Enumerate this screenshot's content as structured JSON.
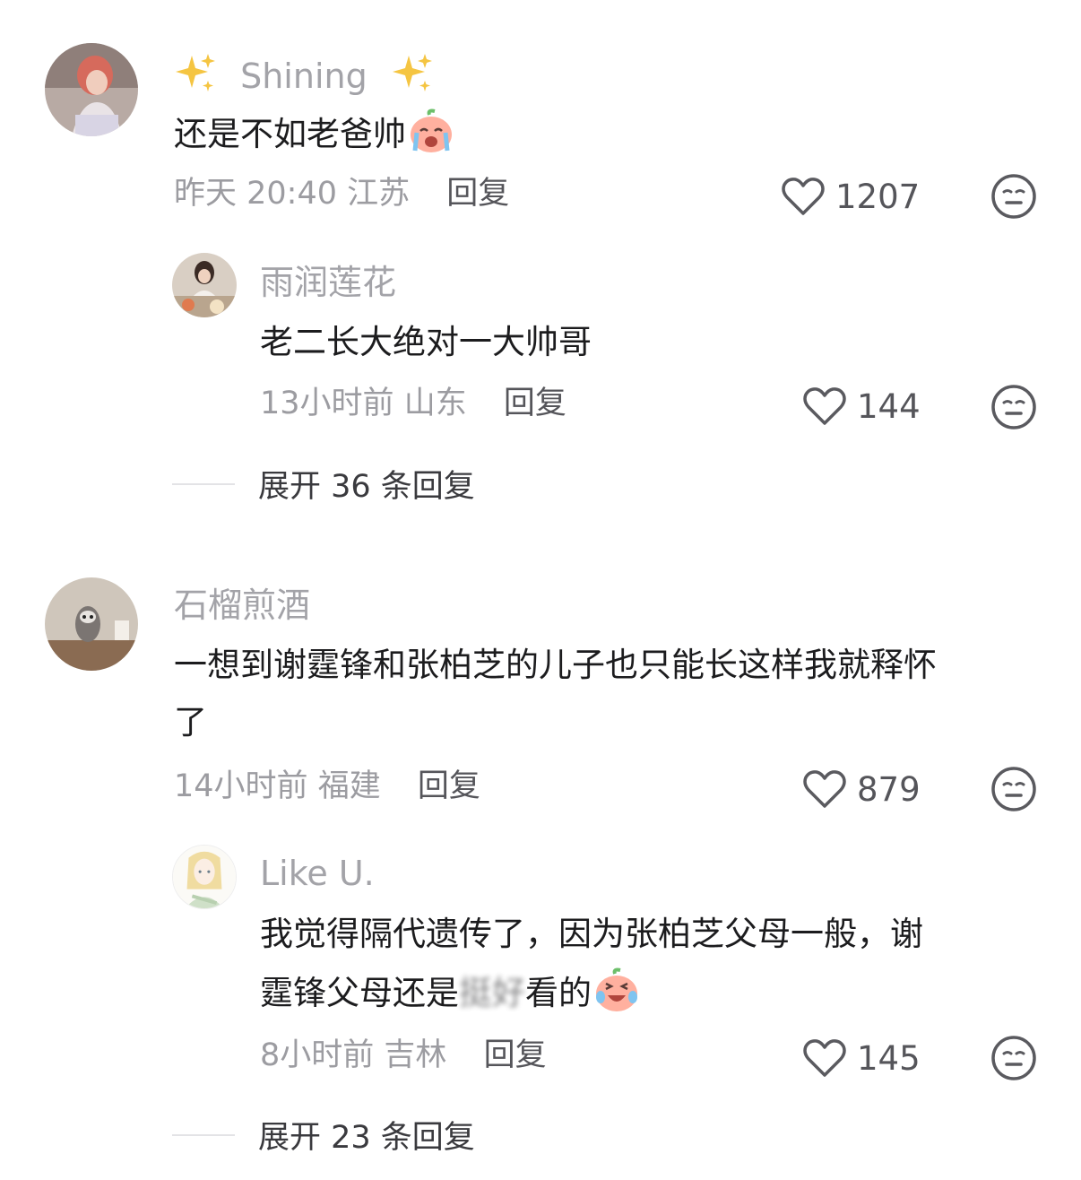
{
  "comments": [
    {
      "username": "Shining",
      "text": "还是不如老爸帅",
      "time": "昨天 20:40",
      "location": "江苏",
      "reply_label": "回复",
      "likes": "1207",
      "replies": [
        {
          "username": "雨润莲花",
          "text": "老二长大绝对一大帅哥",
          "time": "13小时前",
          "location": "山东",
          "reply_label": "回复",
          "likes": "144"
        }
      ],
      "expand_label": "展开 36 条回复"
    },
    {
      "username": "石榴煎酒",
      "text_line1": "一想到谢霆锋和张柏芝的儿子也只能长这样我就释怀",
      "text_line2": "了",
      "time": "14小时前",
      "location": "福建",
      "reply_label": "回复",
      "likes": "879",
      "replies": [
        {
          "username": "Like U.",
          "text_line1": "我觉得隔代遗传了，因为张柏芝父母一般，谢",
          "text_line2_before": "霆锋父母还是",
          "text_line2_blurred": "挺好",
          "text_line2_after": "看的",
          "time": "8小时前",
          "location": "吉林",
          "reply_label": "回复",
          "likes": "145"
        }
      ],
      "expand_label": "展开 23 条回复"
    }
  ],
  "icons": {
    "sparkles": "sparkles-icon",
    "crying_emoji": "crying-face-icon",
    "laughing_crying_emoji": "laugh-cry-face-icon",
    "like": "heart-icon",
    "dislike": "expressionless-face-icon"
  },
  "colors": {
    "username": "#a3a3a8",
    "meta": "#9c9ca1",
    "sparkle": "#f5c542",
    "emoji": "#ff8a7a"
  }
}
